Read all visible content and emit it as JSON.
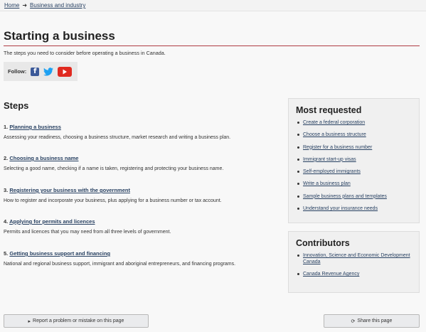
{
  "breadcrumb": {
    "home": "Home",
    "separator": "➜",
    "section": "Business and industry"
  },
  "page": {
    "title": "Starting a business",
    "intro": "The steps you need to consider before operating a business in Canada."
  },
  "follow": {
    "label": "Follow:",
    "networks": [
      "facebook-icon",
      "twitter-icon",
      "youtube-icon"
    ]
  },
  "steps": {
    "heading": "Steps",
    "items": [
      {
        "number": "1.",
        "title": "Planning a business",
        "description": "Assessing your readiness, choosing a business structure, market research and writing a business plan."
      },
      {
        "number": "2.",
        "title": "Choosing a business name",
        "description": "Selecting a good name, checking if a name is taken, registering and protecting your business name."
      },
      {
        "number": "3.",
        "title": "Registering your business with the government",
        "description": "How to register and incorporate your business, plus applying for a business number or tax account."
      },
      {
        "number": "4.",
        "title": "Applying for permits and licences",
        "description": "Permits and licences that you may need from all three levels of government."
      },
      {
        "number": "5.",
        "title": "Getting business support and financing",
        "description": "National and regional business support, immigrant and aboriginal entrepreneurs, and financing programs."
      }
    ]
  },
  "most_requested": {
    "heading": "Most requested",
    "links": [
      "Create a federal corporation",
      "Choose a business structure",
      "Register for a business number",
      "Immigrant start-up visas",
      "Self-employed immigrants",
      "Write a business plan",
      "Sample business plans and templates",
      "Understand your insurance needs"
    ]
  },
  "contributors": {
    "heading": "Contributors",
    "links": [
      "Innovation, Science and Economic Development Canada",
      "Canada Revenue Agency"
    ]
  },
  "footer": {
    "report_icon": "▸",
    "report_label": "Report a problem or mistake on this page",
    "share_icon": "⟳",
    "share_label": "Share this page"
  },
  "colors": {
    "link": "#284162",
    "title_rule": "#af3c43",
    "facebook": "#3b5998",
    "twitter": "#1da1f2",
    "youtube": "#e02a20"
  }
}
